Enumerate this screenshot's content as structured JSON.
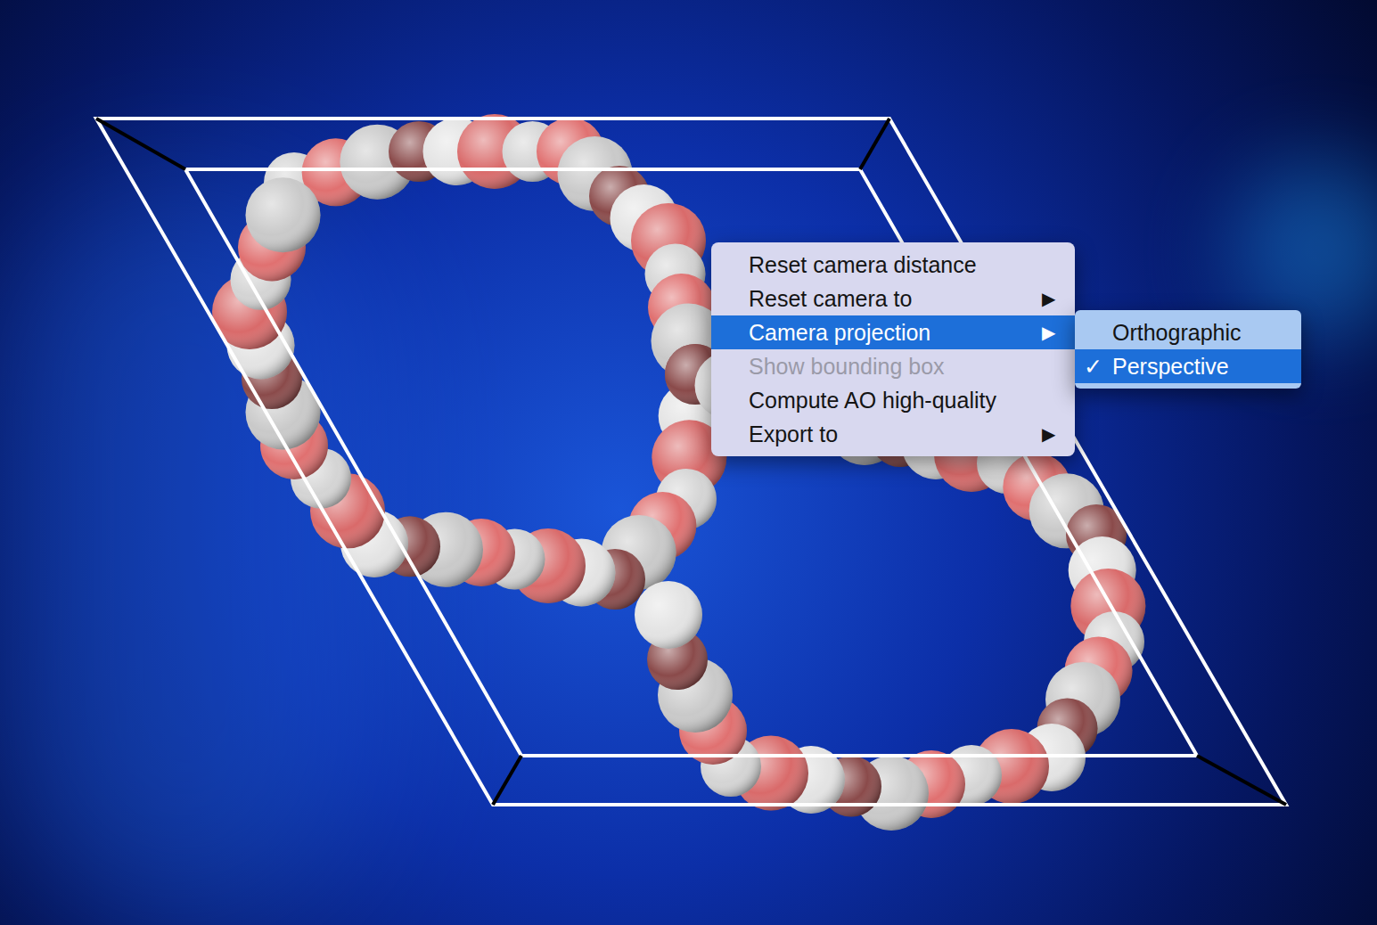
{
  "viewer": {
    "show_unit_cell": true
  },
  "context_menu": {
    "items": [
      {
        "label": "Reset camera distance",
        "arrow": "",
        "disabled": false,
        "selected": false
      },
      {
        "label": "Reset camera to",
        "arrow": "▶",
        "disabled": false,
        "selected": false
      },
      {
        "label": "Camera projection",
        "arrow": "▶",
        "disabled": false,
        "selected": true
      },
      {
        "label": "Show bounding box",
        "arrow": "",
        "disabled": true,
        "selected": false
      },
      {
        "label": "Compute AO high-quality",
        "arrow": "",
        "disabled": false,
        "selected": false
      },
      {
        "label": "Export to",
        "arrow": "▶",
        "disabled": false,
        "selected": false
      }
    ]
  },
  "submenu": {
    "check_mark": "✓",
    "items": [
      {
        "label": "Orthographic",
        "checked": false,
        "selected": false
      },
      {
        "label": "Perspective",
        "checked": true,
        "selected": true
      }
    ]
  }
}
